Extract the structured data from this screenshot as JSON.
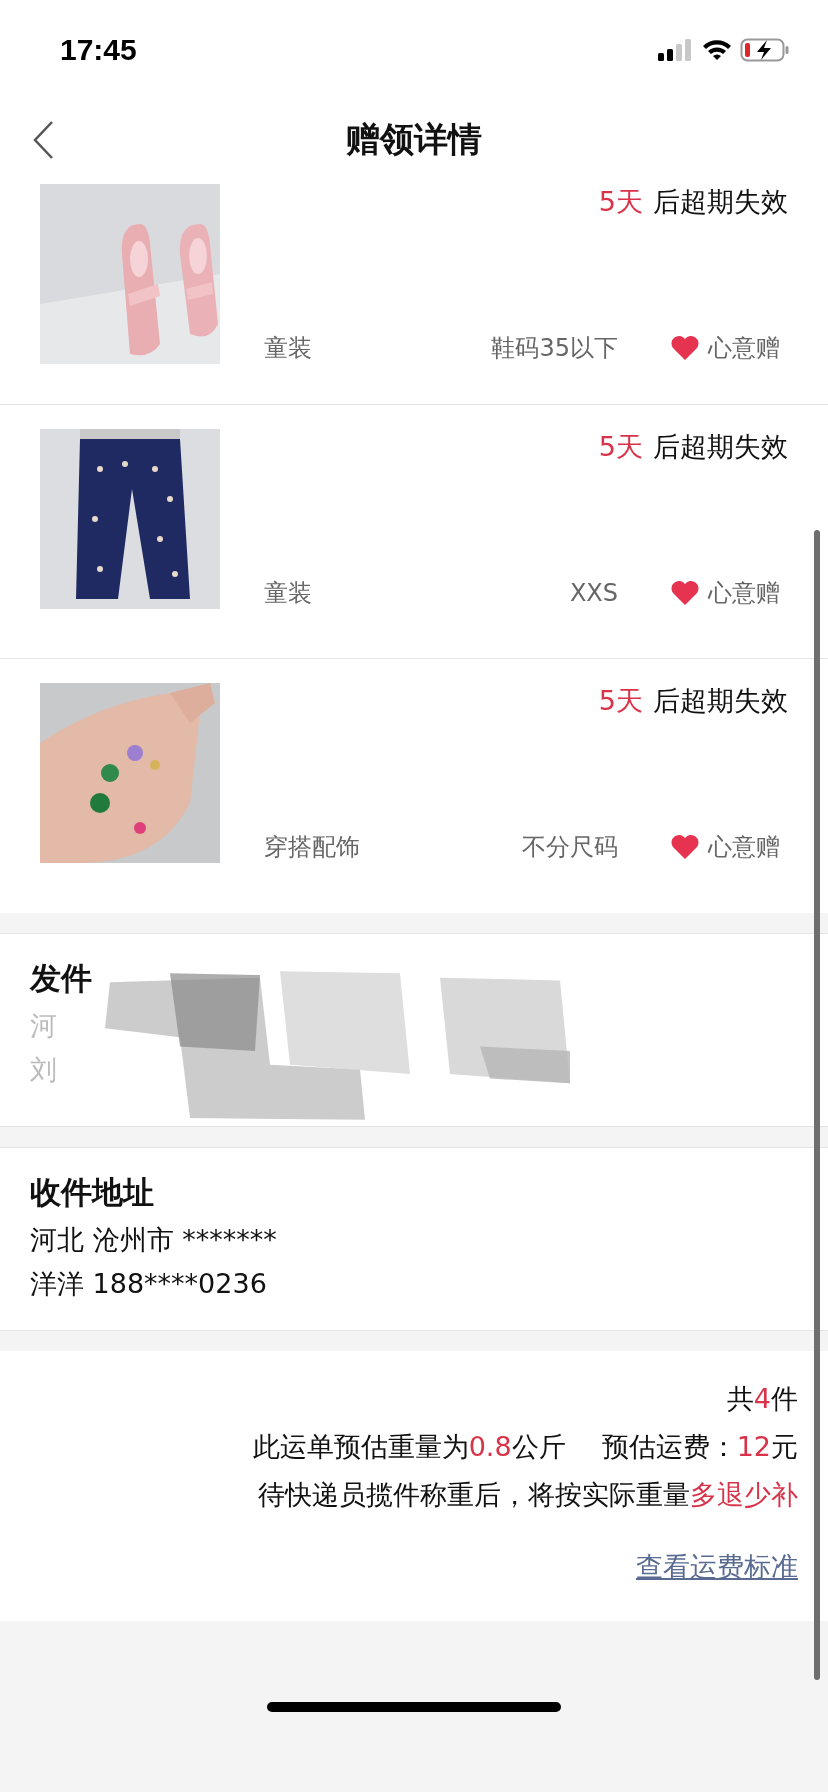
{
  "status_bar": {
    "time": "17:45"
  },
  "header": {
    "title": "赠领详情"
  },
  "items": [
    {
      "countdown": "5天",
      "expiry": "后超期失效",
      "category": "童装",
      "size": "鞋码35以下",
      "gift": "心意赠"
    },
    {
      "countdown": "5天",
      "expiry": "后超期失效",
      "category": "童装",
      "size": "XXS",
      "gift": "心意赠"
    },
    {
      "countdown": "5天",
      "expiry": "后超期失效",
      "category": "穿搭配饰",
      "size": "不分尺码",
      "gift": "心意赠"
    }
  ],
  "sender": {
    "title": "发件",
    "lines": [
      "河",
      "刘"
    ]
  },
  "receiver": {
    "title": "收件地址",
    "lines": [
      "河北 沧州市 *******",
      "洋洋 188****0236"
    ]
  },
  "summary": {
    "lines": [
      [
        {
          "text": "共",
          "highlight": false
        },
        {
          "text": "4",
          "highlight": true
        },
        {
          "text": "件",
          "highlight": false
        }
      ],
      [
        {
          "text": "此运单预估重量为",
          "highlight": false
        },
        {
          "text": "0.8",
          "highlight": true
        },
        {
          "text": "公斤",
          "highlight": false
        },
        {
          "text": "预估运费：",
          "highlight": false
        },
        {
          "text": "12",
          "highlight": true
        },
        {
          "text": "元",
          "highlight": false
        }
      ],
      [
        {
          "text": "待快递员揽件称重后，将按实际重量",
          "highlight": false
        },
        {
          "text": "多退少补",
          "highlight": true
        }
      ]
    ],
    "link": "查看运费标准"
  }
}
